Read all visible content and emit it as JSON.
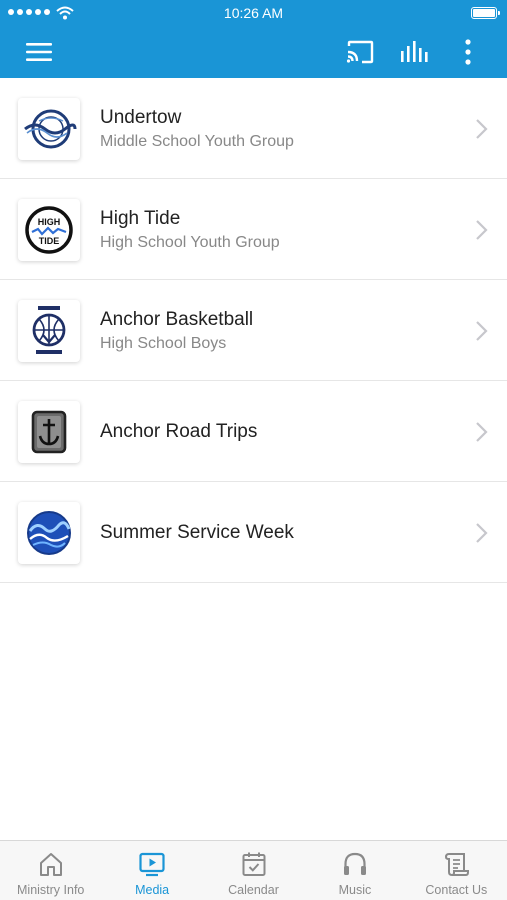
{
  "status_bar": {
    "time": "10:26 AM",
    "signal_icon": "signal-dots-icon",
    "wifi_icon": "wifi-icon",
    "battery_icon": "battery-icon"
  },
  "nav_bar": {
    "menu_icon": "hamburger-menu-icon",
    "cast_icon": "cast-icon",
    "equalizer_icon": "equalizer-icon",
    "more_icon": "more-vertical-icon",
    "background_color": "#1a95d6"
  },
  "items": [
    {
      "title": "Undertow",
      "subtitle": "Middle School Youth Group",
      "logo_icon": "undertow-logo"
    },
    {
      "title": "High Tide",
      "subtitle": "High School Youth Group",
      "logo_icon": "high-tide-logo",
      "logo_text": "HIGH TIDE"
    },
    {
      "title": "Anchor Basketball",
      "subtitle": "High School Boys",
      "logo_icon": "anchor-basketball-logo"
    },
    {
      "title": "Anchor Road Trips",
      "subtitle": "",
      "logo_icon": "anchor-road-trips-logo"
    },
    {
      "title": "Summer Service Week",
      "subtitle": "",
      "logo_icon": "summer-service-week-logo"
    }
  ],
  "tabbar": {
    "active_color": "#1a95d6",
    "inactive_color": "#8a8a8a",
    "tabs": [
      {
        "label": "Ministry Info",
        "icon": "home-icon",
        "active": false
      },
      {
        "label": "Media",
        "icon": "media-play-icon",
        "active": true
      },
      {
        "label": "Calendar",
        "icon": "calendar-icon",
        "active": false
      },
      {
        "label": "Music",
        "icon": "headphones-icon",
        "active": false
      },
      {
        "label": "Contact Us",
        "icon": "contact-scroll-icon",
        "active": false
      }
    ]
  }
}
